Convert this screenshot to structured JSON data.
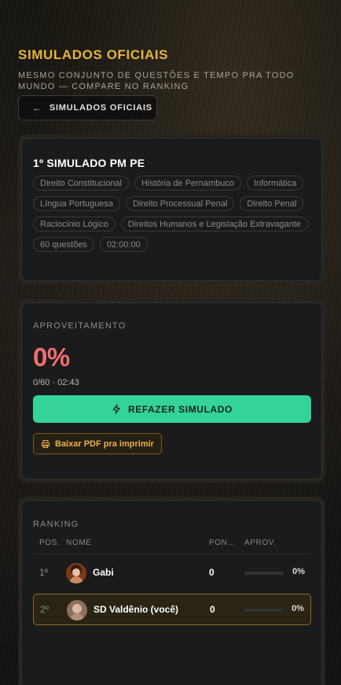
{
  "header": {
    "title": "SIMULADOS OFICIAIS",
    "subtitle": "MESMO CONJUNTO DE QUESTÕES E TEMPO PRA TODO MUNDO — COMPARE NO RANKING"
  },
  "back_button": {
    "icon": "arrow-left-icon",
    "label": "SIMULADOS OFICIAIS"
  },
  "exam": {
    "title": "1º SIMULADO PM PE",
    "tags": [
      "Direito Constitucional",
      "História de Pernambuco",
      "Informática",
      "Língua Portuguesa",
      "Direito Processual Penal",
      "Direito Penal",
      "Raciocínio Lógico",
      "Direitos Humanos e Legislação Extravagante",
      "60 questões",
      "02:00:00"
    ]
  },
  "result": {
    "label": "APROVEITAMENTO",
    "percent": "0%",
    "meta": "0/60 · 02:43",
    "redo_label": "REFAZER SIMULADO",
    "redo_icon": "lightning-icon",
    "pdf_label": "Baixar PDF pra imprimir",
    "pdf_icon": "printer-icon",
    "colors": {
      "percent": "#ef6f6f",
      "accent_green": "#34d399",
      "accent_gold": "#e4b43c"
    }
  },
  "ranking": {
    "label": "RANKING",
    "columns": {
      "pos": "POS.",
      "name": "NOME",
      "points": "PON...",
      "approval": "APROV."
    },
    "rows": [
      {
        "pos": "1º",
        "name": "Gabi",
        "points": "0",
        "approval_fraction": 0,
        "approval": "0%",
        "is_me": false
      },
      {
        "pos": "2º",
        "name": "SD Valdênio (você)",
        "points": "0",
        "approval_fraction": 0,
        "approval": "0%",
        "is_me": true
      }
    ]
  }
}
